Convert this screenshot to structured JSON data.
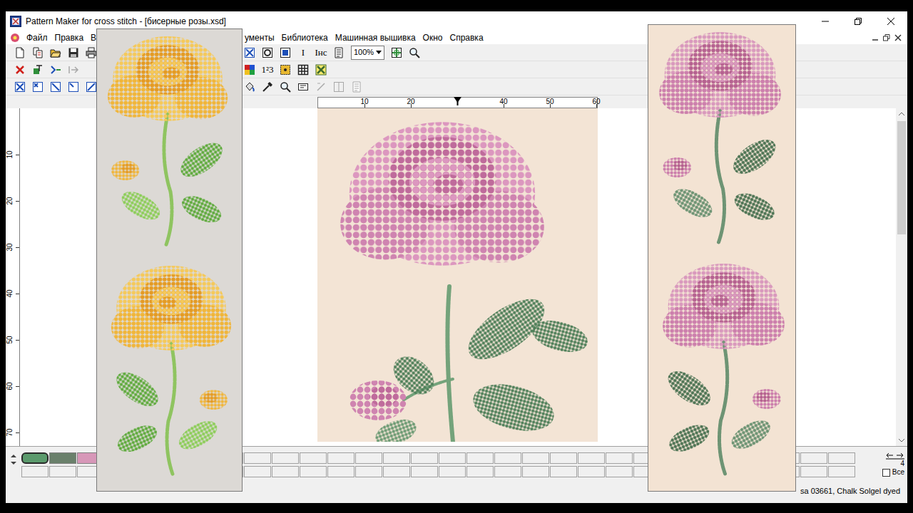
{
  "window": {
    "title": "Pattern Maker for cross stitch - [бисерные розы.xsd]"
  },
  "menu": {
    "left": [
      {
        "label": "Файл"
      },
      {
        "label": "Правка"
      },
      {
        "label": "В"
      }
    ],
    "right": [
      {
        "label": "ументы"
      },
      {
        "label": "Библиотека"
      },
      {
        "label": "Машинная вышивка"
      },
      {
        "label": "Окно"
      },
      {
        "label": "Справка"
      }
    ]
  },
  "toolbars": [
    {
      "left": [
        {
          "kind": "new",
          "disabled": false
        },
        {
          "kind": "copy",
          "disabled": false
        },
        {
          "kind": "open",
          "disabled": false
        },
        {
          "kind": "save",
          "disabled": false
        },
        {
          "kind": "print",
          "disabled": false
        }
      ],
      "right": [
        {
          "kind": "xgrid",
          "disabled": false
        },
        {
          "kind": "target",
          "disabled": false
        },
        {
          "kind": "square",
          "disabled": false
        },
        {
          "kind": "text",
          "glyph": "I",
          "disabled": false
        },
        {
          "kind": "text",
          "glyph": "Iнс",
          "disabled": false
        },
        {
          "kind": "doc",
          "disabled": false
        },
        {
          "kind": "select",
          "value": "100%",
          "disabled": false
        },
        {
          "kind": "fit",
          "disabled": false
        },
        {
          "kind": "zoom",
          "disabled": false
        }
      ]
    },
    {
      "left": [
        {
          "kind": "xred",
          "disabled": false
        },
        {
          "kind": "add",
          "disabled": false
        },
        {
          "kind": "remove",
          "disabled": false
        },
        {
          "kind": "arrow",
          "disabled": true
        }
      ],
      "right": [
        {
          "kind": "colors",
          "disabled": false
        },
        {
          "kind": "text",
          "glyph": "1²3",
          "disabled": false
        },
        {
          "kind": "dots",
          "disabled": false
        },
        {
          "kind": "grid",
          "disabled": false
        },
        {
          "kind": "xbox",
          "disabled": false
        }
      ]
    },
    {
      "left": [
        {
          "kind": "xgrid",
          "disabled": false
        },
        {
          "kind": "xsmall",
          "disabled": false
        },
        {
          "kind": "diag",
          "disabled": false
        },
        {
          "kind": "diag2",
          "disabled": false
        },
        {
          "kind": "diagbox",
          "disabled": false
        }
      ],
      "right": [
        {
          "kind": "bucket",
          "disabled": false
        },
        {
          "kind": "dropper",
          "disabled": false
        },
        {
          "kind": "zoom",
          "disabled": false
        },
        {
          "kind": "scissors",
          "disabled": false
        },
        {
          "kind": "line",
          "disabled": true
        },
        {
          "kind": "split",
          "disabled": true
        },
        {
          "kind": "doc",
          "disabled": true
        }
      ]
    }
  ],
  "ruler": {
    "horizontal": [
      "10",
      "20",
      "40",
      "50",
      "60"
    ],
    "vertical": [
      "10",
      "20",
      "30",
      "40",
      "50",
      "60",
      "70"
    ]
  },
  "vertical_scrollbar": {
    "level": 0.36
  },
  "palette": {
    "swatches": [
      {
        "color": "#5b9a6c",
        "selected": true
      },
      {
        "color": "#6a806b",
        "selected": false
      },
      {
        "color": "#d797b8",
        "selected": false
      }
    ]
  },
  "palette_pager": {
    "label": "4"
  },
  "show_all": {
    "label": "Все",
    "checked": false
  },
  "status_bar": {
    "text": "sa 03661, Chalk Solgel dyed"
  }
}
